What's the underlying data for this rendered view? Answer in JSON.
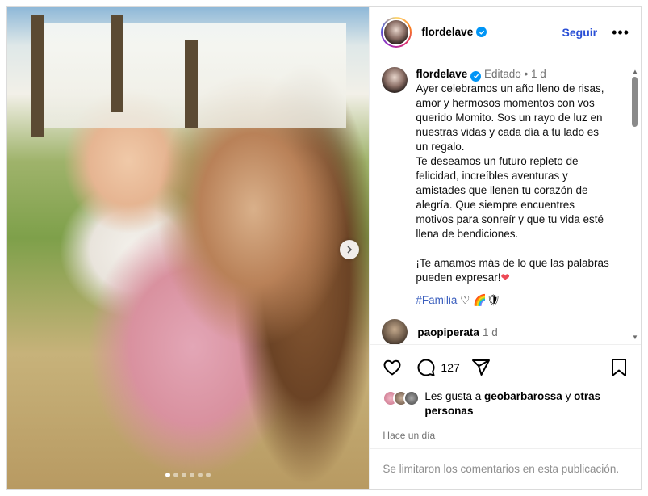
{
  "post": {
    "author": "flordelave",
    "follow_label": "Seguir",
    "more_label": "•••",
    "media": {
      "slide_count": 6,
      "current_slide": 1
    }
  },
  "caption": {
    "author": "flordelave",
    "edited": "Editado",
    "separator": "•",
    "time": "1 d",
    "text": "Ayer celebramos un año lleno de risas, amor y hermosos momentos con vos querido Momito. Sos un rayo de luz en nuestras vidas y cada día a tu lado es un regalo.\nTe deseamos un futuro repleto de felicidad, increíbles aventuras y amistades que llenen tu corazón de alegría. Que siempre encuentres motivos para sonreír y que tu vida esté llena de bendiciones.\n\n¡Te amamos más de lo que las palabras pueden expresar!",
    "text_emoji": "❤",
    "hashtag": "#Familia",
    "trailing_emojis": "♡ 🌈🛡"
  },
  "reply": {
    "author": "paopiperata",
    "time": "1 d"
  },
  "actions": {
    "comment_count": "127"
  },
  "likes": {
    "prefix": "Les gusta a",
    "user": "geobarbarossa",
    "joiner": "y",
    "others": "otras personas"
  },
  "timestamp": "Hace un día",
  "comments_limited": "Se limitaron los comentarios en esta publicación.",
  "colors": {
    "follow": "#2a4fd6",
    "verified": "#0095f6",
    "hashtag": "#3b5fbe",
    "muted": "#737373"
  }
}
